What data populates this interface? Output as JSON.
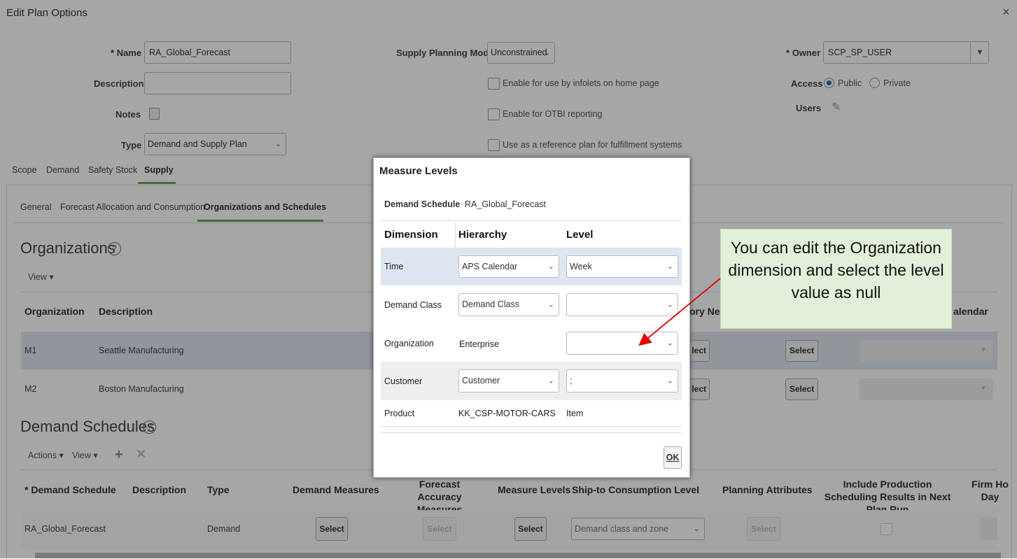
{
  "page": {
    "title": "Edit Plan Options",
    "close": "×"
  },
  "form": {
    "name_label": "Name",
    "name_value": "RA_Global_Forecast",
    "desc_label": "Description",
    "desc_value": "",
    "notes_label": "Notes",
    "type_label": "Type",
    "type_value": "Demand and Supply Plan",
    "spm_label": "Supply Planning Mode",
    "spm_value": "Unconstrained",
    "chk1": "Enable for use by infolets on home page",
    "chk2": "Enable for OTBI reporting",
    "chk3": "Use as a reference plan for fulfillment systems",
    "owner_label": "Owner",
    "owner_value": "SCP_SP_USER",
    "access_label": "Access",
    "access_public": "Public",
    "access_private": "Private",
    "users_label": "Users",
    "required": "*"
  },
  "tabs": [
    "Scope",
    "Demand",
    "Safety Stock",
    "Supply"
  ],
  "subtabs": [
    "General",
    "Forecast Allocation and Consumption",
    "Organizations and Schedules"
  ],
  "orgs": {
    "title": "Organizations",
    "help": "?",
    "view": "View ▾",
    "col_org": "Organization",
    "col_desc": "Description",
    "col_net": "ory Net",
    "col_cal": "alendar",
    "rows": [
      {
        "org": "M1",
        "desc": "Seattle Manufacturing",
        "btn1": "lect",
        "btn2": "Select"
      },
      {
        "org": "M2",
        "desc": "Boston Manufacturing",
        "btn1": "lect",
        "btn2": "Select"
      }
    ]
  },
  "ds": {
    "title": "Demand Schedules",
    "help": "?",
    "actions": "Actions ▾",
    "view": "View ▾",
    "cols": [
      "Demand Schedule",
      "Description",
      "Type",
      "Demand Measures",
      "Forecast Accuracy Measures",
      "Measure Levels",
      "Ship-to Consumption Level",
      "Planning Attributes",
      "Include Production Scheduling Results in Next Plan Run",
      "Firm Ho Day"
    ],
    "row": {
      "schedule": "RA_Global_Forecast",
      "type": "Demand",
      "select": "Select",
      "ship": "Demand class and zone"
    }
  },
  "dialog": {
    "title": "Measure Levels",
    "ds_label": "Demand Schedule",
    "ds_value": "RA_Global_Forecast",
    "col_dim": "Dimension",
    "col_hier": "Hierarchy",
    "col_level": "Level",
    "rows": [
      {
        "dim": "Time",
        "hier": "APS Calendar",
        "level": "Week"
      },
      {
        "dim": "Demand Class",
        "hier": "Demand Class",
        "level": ""
      },
      {
        "dim": "Organization",
        "hier": "Enterprise",
        "level": ""
      },
      {
        "dim": "Customer",
        "hier": "Customer",
        "level": ";"
      },
      {
        "dim": "Product",
        "hier": "KK_CSP-MOTOR-CARS",
        "level": "Item"
      }
    ],
    "ok": "OK"
  },
  "callout": {
    "text": "You can edit the Organization dimension and select the level value as null"
  },
  "colors": {
    "callout_bg": "#e2efd9",
    "arrow": "#e00000",
    "tab_underline": "#6aa84f"
  }
}
